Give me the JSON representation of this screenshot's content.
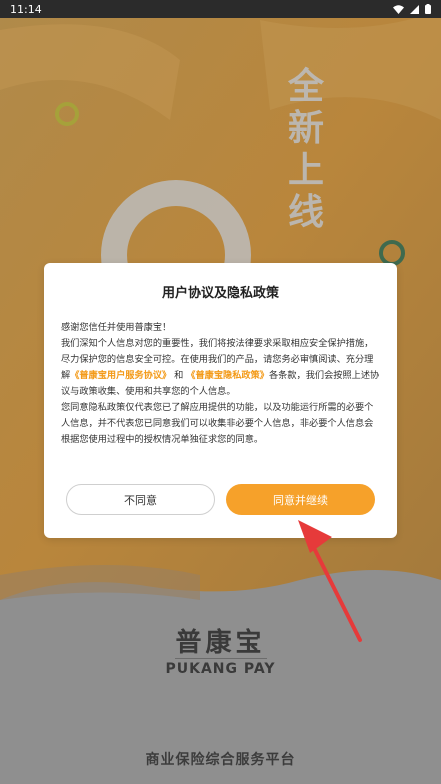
{
  "status_bar": {
    "time": "11:14"
  },
  "background": {
    "vertical_title": [
      "全",
      "新",
      "上",
      "线"
    ]
  },
  "dialog": {
    "title": "用户协议及隐私政策",
    "greeting": "感谢您信任并使用普康宝！",
    "para1_a": "我们深知个人信息对您的重要性，我们将按法律要求采取相应安全保护措施，尽力保护您的信息安全可控。在使用我们的产品，请您务必审慎阅读、充分理解",
    "link_service": "《普康宝用户服务协议》",
    "para1_and": "和",
    "link_privacy": "《普康宝隐私政策》",
    "para1_b": "各条款，我们会按照上述协议与政策收集、使用和共享您的个人信息。",
    "para2": "您同意隐私政策仅代表您已了解应用提供的功能，以及功能运行所需的必要个人信息，并不代表您已同意我们可以收集非必要个人信息，非必要个人信息会根据您使用过程中的授权情况单独征求您的同意。",
    "disagree_label": "不同意",
    "agree_label": "同意并继续"
  },
  "brand": {
    "name_cn": "普康宝",
    "name_en": "PUKANG PAY",
    "tagline": "商业保险综合服务平台"
  },
  "colors": {
    "accent": "#f6a12a",
    "link": "#f39a18",
    "overlay_gray": "#8f8f8f",
    "pointer_arrow": "#e63a3a"
  }
}
